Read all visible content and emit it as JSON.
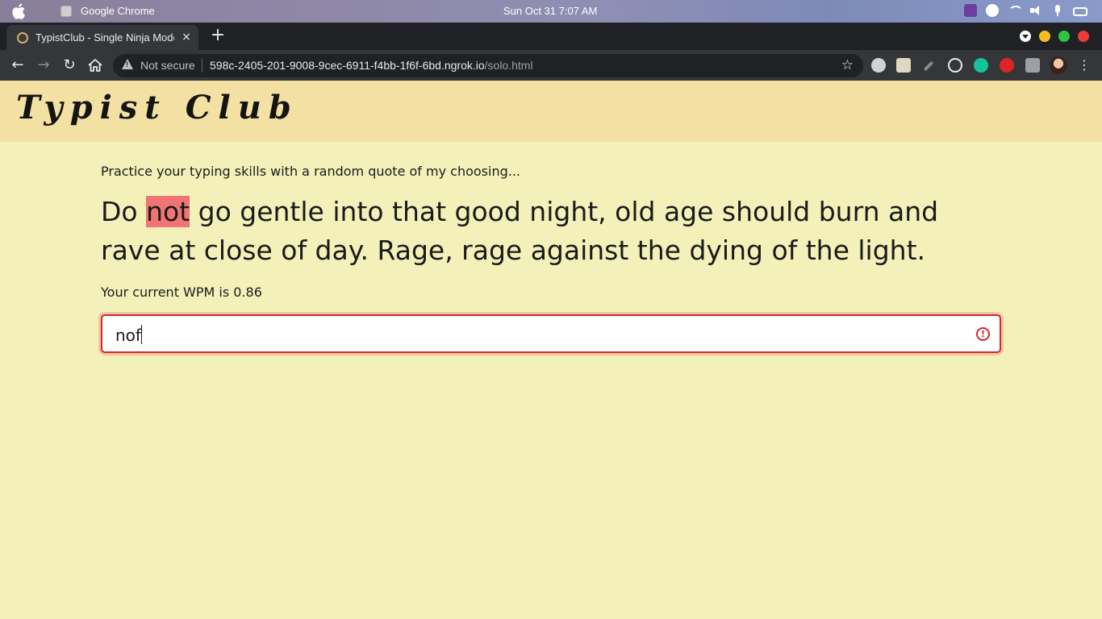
{
  "os_bar": {
    "app_name": "Google Chrome",
    "clock": "Sun Oct 31   7:07 AM",
    "icons": [
      "apple-icon",
      "chrome-app-icon",
      "app-tray-icon",
      "accessibility-icon",
      "wifi-icon",
      "volume-icon",
      "microphone-icon",
      "battery-icon"
    ]
  },
  "browser": {
    "tab_title": "TypistClub - Single Ninja Mode",
    "tab_close": "×",
    "new_tab": "+",
    "security_label": "Not secure",
    "url_host": "598c-2405-201-9008-9cec-6911-f4bb-1f6f-6bd.ngrok.io",
    "url_path": "/solo.html",
    "window_controls": [
      "#f4bf1e",
      "#2dc640",
      "#ee3b33"
    ]
  },
  "page": {
    "logo": "Typist Club",
    "subtitle": "Practice your typing skills with a random quote of my choosing...",
    "quote_before": "Do ",
    "quote_highlight": "not",
    "quote_after": " go gentle into that good night, old age should burn and rave at close of day. Rage, rage against the dying of the light.",
    "highlight_color": "#f07474",
    "wpm_text": "Your current WPM is 0.86",
    "input_value": "nof",
    "error_color": "#d5262f",
    "error_icon": "!"
  }
}
